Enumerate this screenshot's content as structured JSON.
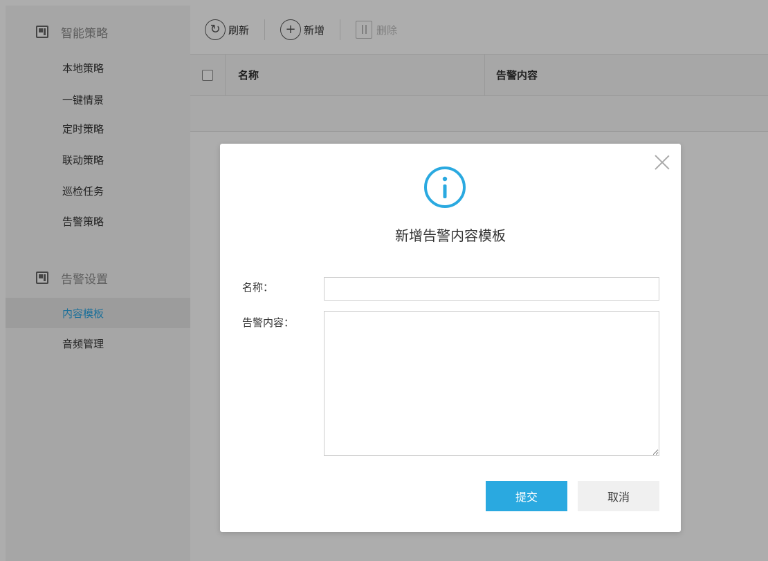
{
  "sidebar": {
    "groups": [
      {
        "title": "智能策略",
        "items": [
          {
            "label": "本地策略"
          },
          {
            "label": "一键情景"
          },
          {
            "label": "定时策略"
          },
          {
            "label": "联动策略"
          },
          {
            "label": "巡检任务"
          },
          {
            "label": "告警策略"
          }
        ]
      },
      {
        "title": "告警设置",
        "items": [
          {
            "label": "内容模板",
            "active": true
          },
          {
            "label": "音频管理"
          }
        ]
      }
    ]
  },
  "toolbar": {
    "refresh_label": "刷新",
    "add_label": "新增",
    "delete_label": "删除"
  },
  "table": {
    "columns": [
      "名称",
      "告警内容"
    ]
  },
  "modal": {
    "title": "新增告警内容模板",
    "name_label": "名称：",
    "content_label": "告警内容：",
    "name_value": "",
    "content_value": "",
    "submit_label": "提交",
    "cancel_label": "取消"
  },
  "colors": {
    "accent": "#2aa9e0",
    "active_nav": "#2aa5e3"
  }
}
